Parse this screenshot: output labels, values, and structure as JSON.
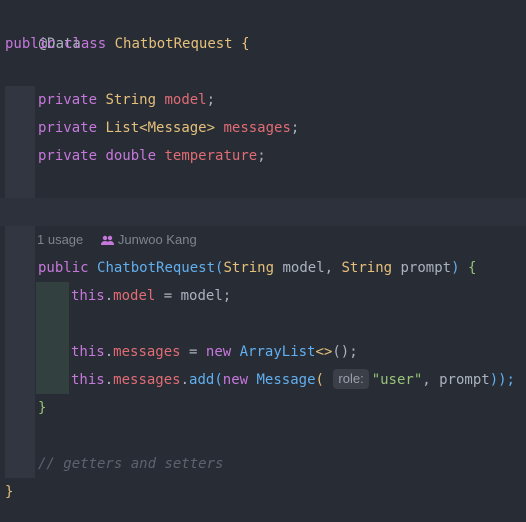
{
  "code": {
    "annotation": "@Data",
    "class_decl": {
      "modifier": "public",
      "keyword": "class",
      "name": "ChatbotRequest",
      "open_brace": "{"
    },
    "fields": [
      {
        "modifier": "private",
        "type": "String",
        "name": "model",
        "end": ";"
      },
      {
        "modifier": "private",
        "type_generic": "List",
        "type_param": "<Message>",
        "name": "messages",
        "end": ";"
      },
      {
        "modifier": "private",
        "type": "double",
        "name": "temperature",
        "end": ";"
      }
    ],
    "code_lens": {
      "usages": "1 usage",
      "author": "Junwoo Kang"
    },
    "constructor": {
      "modifier": "public",
      "name": "ChatbotRequest",
      "open_paren": "(",
      "param1_type": "String",
      "param1_name": " model, ",
      "param2_type": "String",
      "param2_name": " prompt",
      "close_paren": ")",
      "open_brace": "{",
      "close_brace": "}"
    },
    "body": {
      "line1": {
        "this": "this",
        "dot": ".",
        "field": "model",
        "rest": " = model;"
      },
      "line2": {
        "this": "this",
        "dot": ".",
        "field": "messages",
        "assign": " = ",
        "new": "new",
        "type": "ArrayList",
        "diamond": "<>",
        "call": "();"
      },
      "line3": {
        "this": "this",
        "dot": ".",
        "field": "messages",
        "dot2": ".",
        "method": "add",
        "open": "(",
        "new": "new",
        "type": "Message",
        "open2": "(",
        "hint": "role:",
        "string": "\"user\"",
        "rest": ", prompt",
        "close": "));"
      }
    },
    "comment": "// getters and setters",
    "class_close": "}"
  },
  "icons": {
    "author_icon": "people-icon"
  }
}
